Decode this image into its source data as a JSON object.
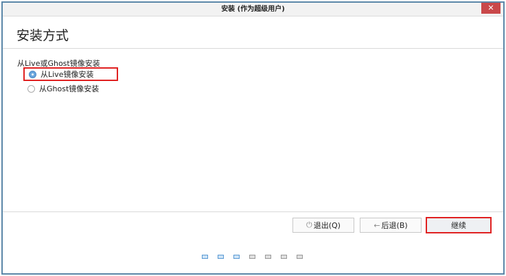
{
  "window": {
    "title": "安装 (作为超级用户)",
    "close_label": "✕"
  },
  "header": {
    "title": "安装方式"
  },
  "content": {
    "group_label": "从Live或Ghost镜像安装",
    "options": [
      {
        "label": "从Live镜像安装",
        "selected": true
      },
      {
        "label": "从Ghost镜像安装",
        "selected": false
      }
    ]
  },
  "footer": {
    "quit_label": "退出(Q)",
    "quit_icon": "power-icon",
    "back_label": "后退(B)",
    "back_icon": "arrow-left-icon",
    "continue_label": "继续"
  },
  "progress": {
    "total_steps": 7,
    "completed_steps": 3
  }
}
